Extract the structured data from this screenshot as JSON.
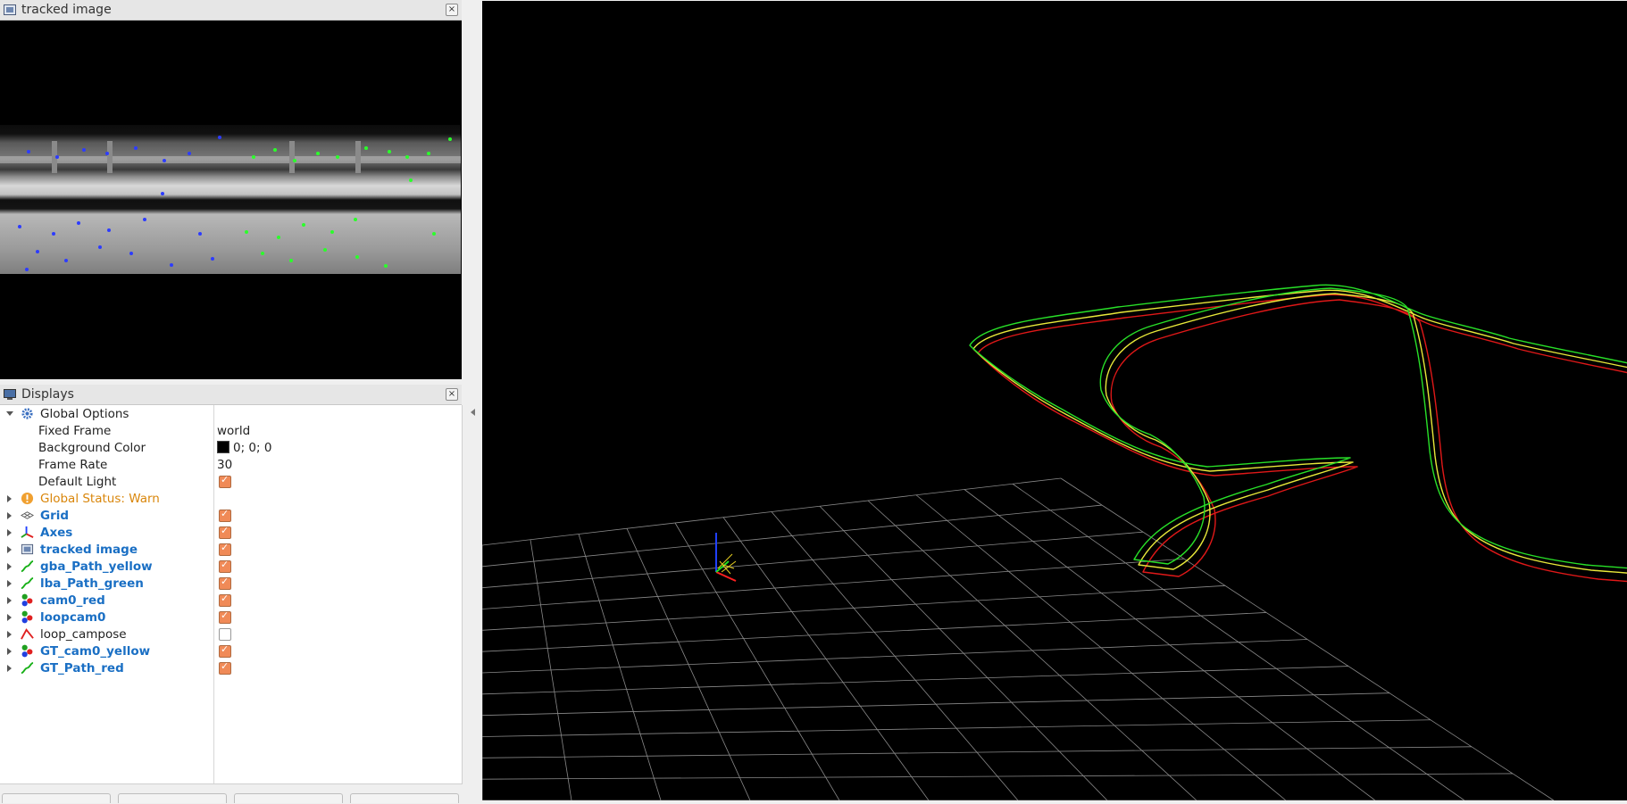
{
  "tracked_image_panel": {
    "title": "tracked image",
    "close_glyph": "×"
  },
  "displays_panel": {
    "title": "Displays",
    "close_glyph": "×",
    "global_options": {
      "label": "Global Options",
      "fixed_frame": {
        "label": "Fixed Frame",
        "value": "world"
      },
      "background_color": {
        "label": "Background Color",
        "value": "0; 0; 0"
      },
      "frame_rate": {
        "label": "Frame Rate",
        "value": "30"
      },
      "default_light": {
        "label": "Default Light",
        "checked": true
      }
    },
    "global_status": {
      "label": "Global Status: Warn",
      "color": "#d9860b"
    },
    "items": [
      {
        "label": "Grid",
        "icon": "grid-icon",
        "checked": true
      },
      {
        "label": "Axes",
        "icon": "axes-icon",
        "checked": true
      },
      {
        "label": "tracked image",
        "icon": "image-icon",
        "checked": true
      },
      {
        "label": "gba_Path_yellow",
        "icon": "path-icon",
        "checked": true
      },
      {
        "label": "lba_Path_green",
        "icon": "path-icon",
        "checked": true
      },
      {
        "label": "cam0_red",
        "icon": "marker-icon",
        "checked": true
      },
      {
        "label": "loopcam0",
        "icon": "marker-icon",
        "checked": true
      },
      {
        "label": "loop_campose",
        "icon": "pose-icon",
        "checked": false
      },
      {
        "label": "GT_cam0_yellow",
        "icon": "marker-icon",
        "checked": true
      },
      {
        "label": "GT_Path_red",
        "icon": "path-icon",
        "checked": true
      }
    ]
  },
  "colors": {
    "path_green": "#28e028",
    "path_yellow": "#e8e83a",
    "path_red": "#e01818",
    "grid": "#8a8a8a",
    "checkbox_checked": "#f08a57",
    "enabled_label": "#1a6fc4"
  }
}
